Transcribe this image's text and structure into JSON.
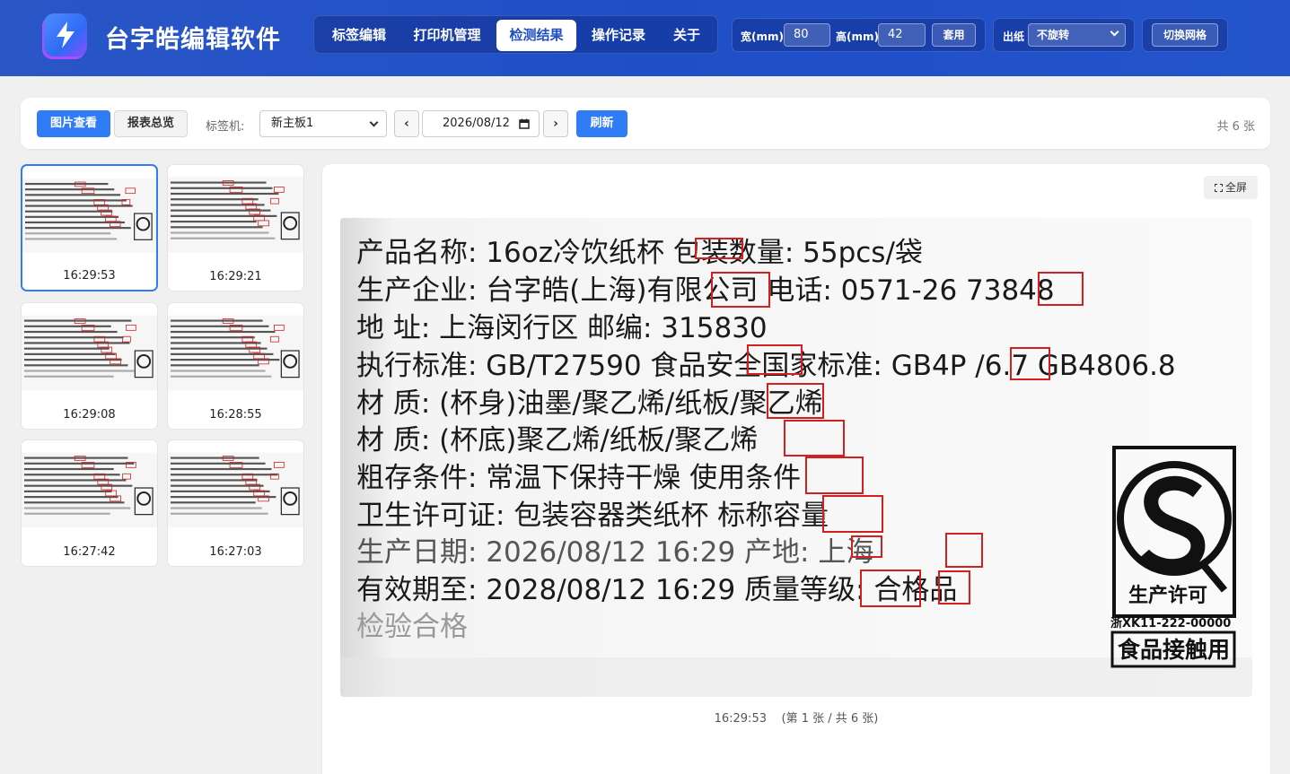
{
  "app": {
    "title": "台字皓编辑软件",
    "logo_icon": "lightning-icon"
  },
  "nav": {
    "tabs": [
      "标签编辑",
      "打印机管理",
      "检测结果",
      "操作记录",
      "关于"
    ],
    "active": "检测结果"
  },
  "size": {
    "width_label": "宽(mm)",
    "width_value": "80",
    "height_label": "高(mm)",
    "height_value": "42",
    "apply_label": "套用"
  },
  "output": {
    "label": "出纸",
    "selected": "不旋转"
  },
  "grid_button": "切换网格",
  "toolbar": {
    "view_image": "图片查看",
    "report": "报表总览",
    "printer_label": "标签机:",
    "printer_selected": "新主板1",
    "prev": "‹",
    "date": "2026/08/12",
    "next": "›",
    "refresh": "刷新",
    "total": "共 6 张"
  },
  "thumbnails": [
    {
      "time": "16:29:53",
      "selected": true
    },
    {
      "time": "16:29:21"
    },
    {
      "time": "16:29:08"
    },
    {
      "time": "16:28:55"
    },
    {
      "time": "16:27:42"
    },
    {
      "time": "16:27:03"
    }
  ],
  "viewer": {
    "fullscreen_label": "全屏",
    "caption_time": "16:29:53",
    "caption_page": "(第 1 张 / 共 6 张)"
  },
  "label_content": {
    "line1": "产品名称: 16oz冷饮纸杯 包装数量: 55pcs/袋",
    "line2": "生产企业: 台字皓(上海)有限公司 电话: 0571-26 73848",
    "line3": "地 址: 上海闵行区 邮编: 315830",
    "line4": "执行标准: GB/T27590 食品安全国家标准: GB4P /6.7 GB4806.8",
    "line5": "材 质: (杯身)油墨/聚乙烯/纸板/聚乙烯",
    "line6": "材 质: (杯底)聚乙烯/纸板/聚乙烯",
    "line7": "粗存条件: 常温下保持干燥 使用条件",
    "line8": "卫生许可证: 包装容器类纸杯 标称容量",
    "line9": "生产日期: 2026/08/12 16:29 产地: 上海",
    "line10": "有效期至: 2028/08/12 16:29 质量等级: 合格品",
    "line11": "检验合格",
    "qs_license": "生产许可",
    "qs_number": "浙XK11-222-00000",
    "qs_food": "食品接触用"
  },
  "colors": {
    "header": "#2354cc",
    "accent": "#2f7cf6",
    "defect_box": "#d22020"
  }
}
